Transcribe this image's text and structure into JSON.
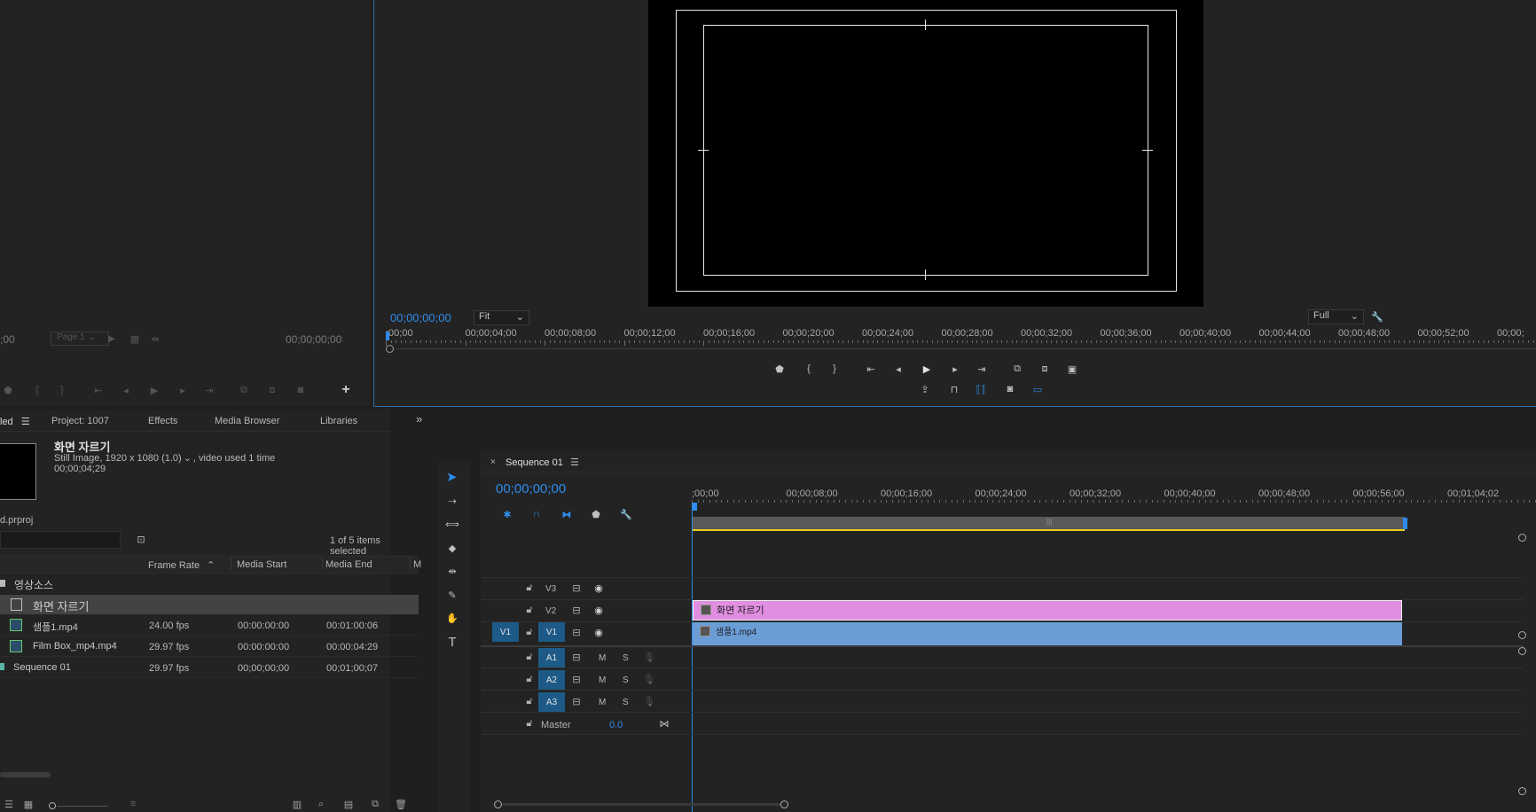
{
  "source_monitor": {
    "timecode_left": ";00",
    "page_select": "Page 1",
    "timecode_right": "00;00;00;00"
  },
  "program_monitor": {
    "timecode": "00;00;00;00",
    "fit_label": "Fit",
    "full_label": "Full",
    "ruler": [
      ";00;00",
      "00;00;04;00",
      "00;00;08;00",
      "00;00;12;00",
      "00;00;16;00",
      "00;00;20;00",
      "00;00;24;00",
      "00;00;28;00",
      "00;00;32;00",
      "00;00;36;00",
      "00;00;40;00",
      "00;00;44;00",
      "00;00;48;00",
      "00;00;52;00",
      "00;00;"
    ]
  },
  "project_panel": {
    "tabs": [
      "led",
      "Project: 1007",
      "Effects",
      "Media Browser",
      "Libraries"
    ],
    "preview_title": "화면 자르기",
    "preview_info1": "Still Image, 1920 x 1080 (1.0)",
    "preview_info1b": ", video used 1 time",
    "preview_info2": "00;00;04;29",
    "project_file": "d.prproj",
    "items_selected": "1 of 5 items selected",
    "columns": [
      "Frame Rate",
      "Media Start",
      "Media End",
      "M"
    ],
    "folder": "영상소스",
    "rows": [
      {
        "name": "화면 자르기",
        "fps": "",
        "start": "",
        "end": ""
      },
      {
        "name": "샘플1.mp4",
        "fps": "24.00 fps",
        "start": "00:00:00:00",
        "end": "00:01:00:06"
      },
      {
        "name": "Film Box_mp4.mp4",
        "fps": "29.97 fps",
        "start": "00:00:00:00",
        "end": "00:00:04:29"
      },
      {
        "name": "Sequence 01",
        "fps": "29.97 fps",
        "start": "00;00;00;00",
        "end": "00;01;00;07"
      }
    ]
  },
  "timeline": {
    "tab_title": "Sequence 01",
    "timecode": "00;00;00;00",
    "ruler": [
      ";00;00",
      "00;00;08;00",
      "00;00;16;00",
      "00;00;24;00",
      "00;00;32;00",
      "00;00;40;00",
      "00;00;48;00",
      "00;00;56;00",
      "00;01;04;02"
    ],
    "video_tracks": [
      "V3",
      "V2",
      "V1"
    ],
    "source_patch": "V1",
    "audio_tracks": [
      "A1",
      "A2",
      "A3"
    ],
    "master_label": "Master",
    "master_value": "0.0",
    "clip_v2": "화면 자르기",
    "clip_v1": "샘플1.mp4",
    "m_label": "M",
    "s_label": "S"
  },
  "colors": {
    "accent": "#2d8ceb",
    "clip_pink": "#e08ee0",
    "clip_blue": "#6a9cd6",
    "track_toggle": "#1d5a88"
  }
}
